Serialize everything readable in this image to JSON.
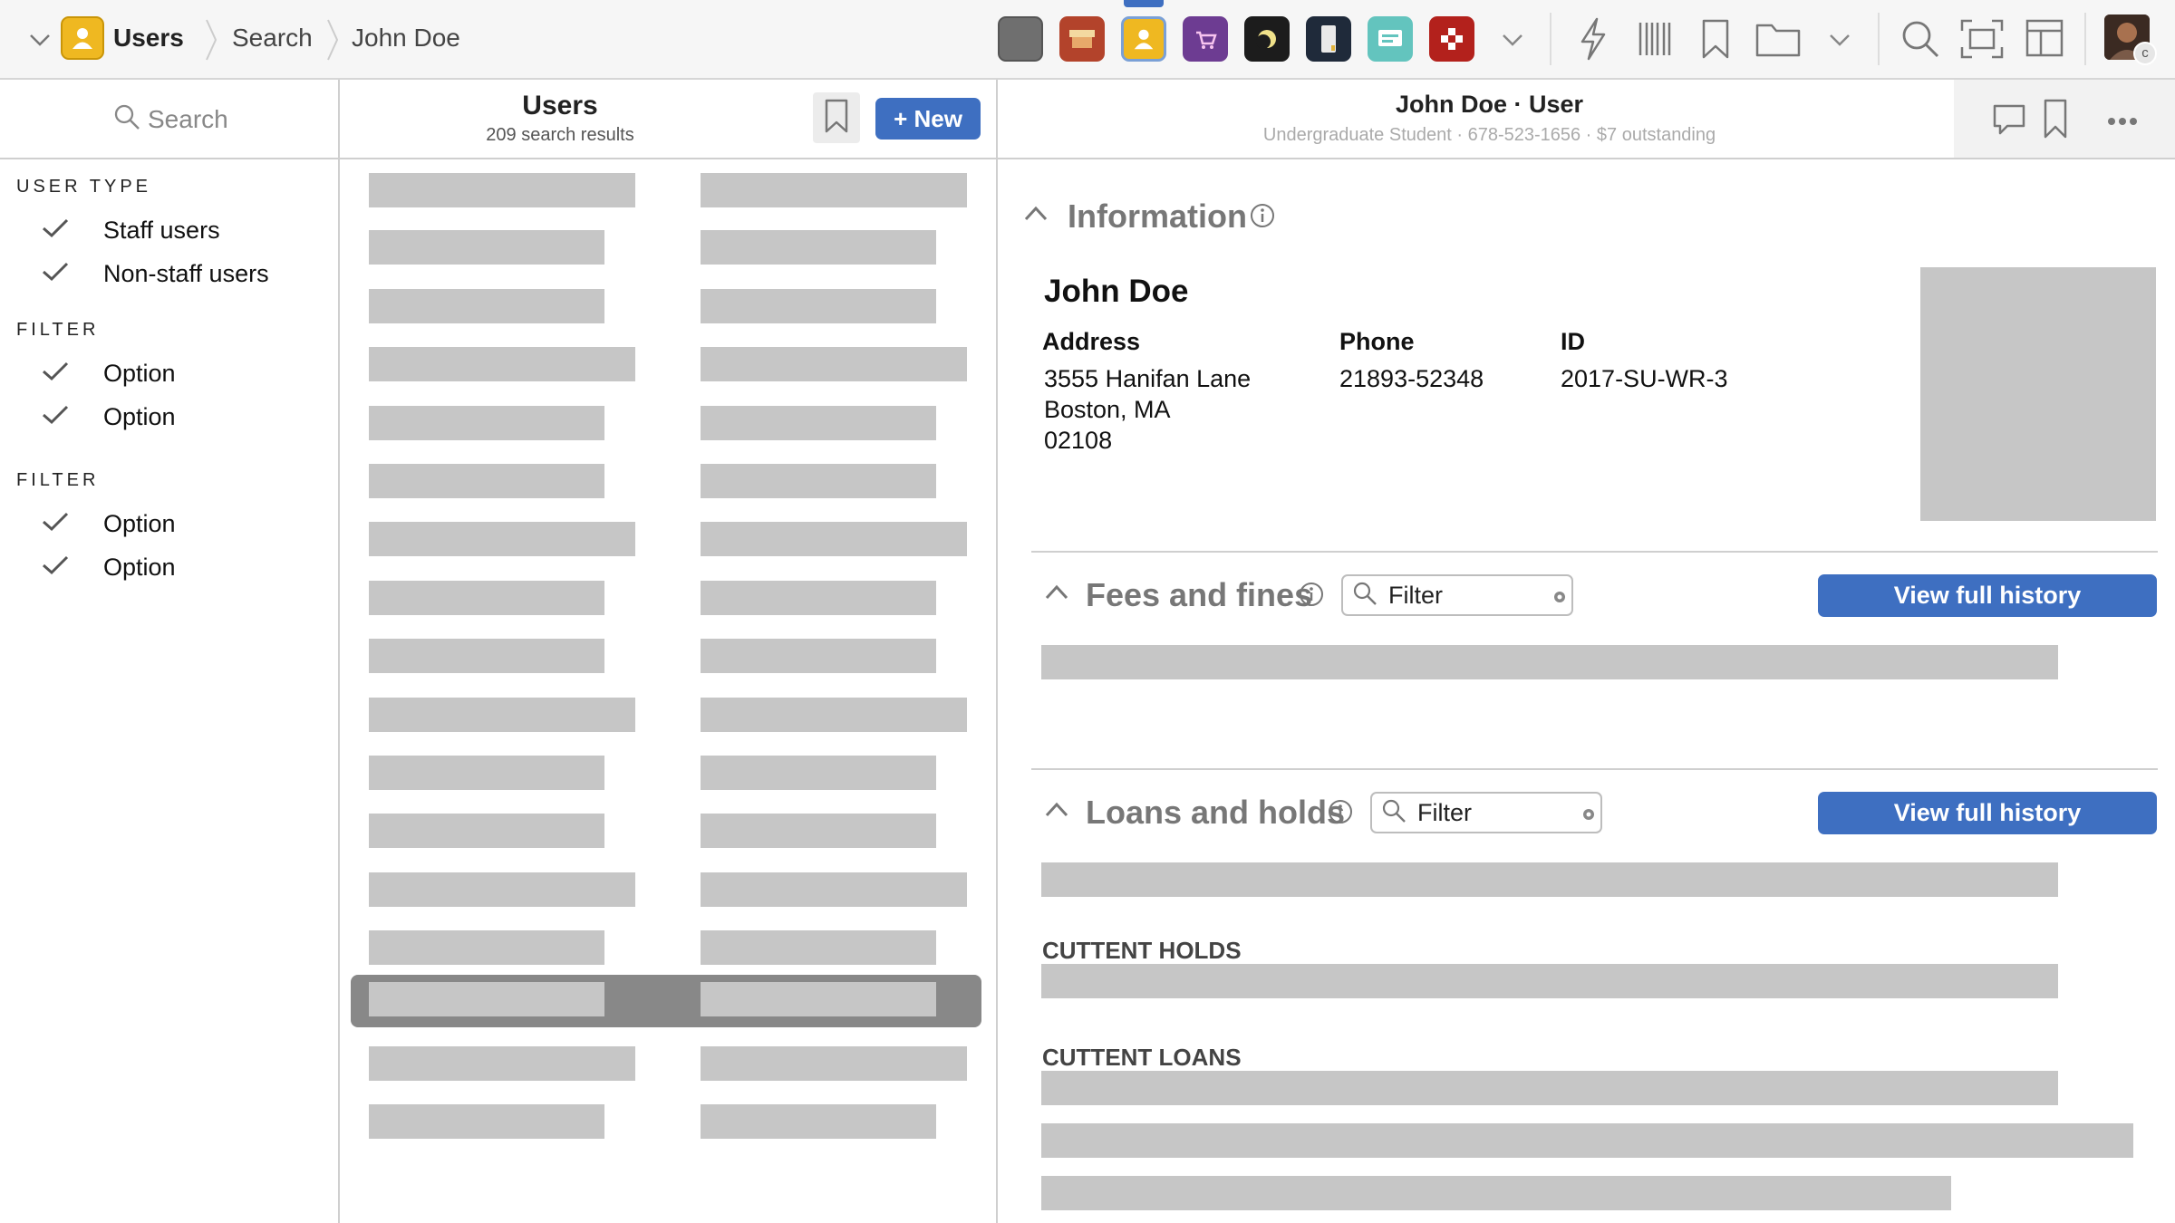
{
  "topbar": {
    "app_name": "Users",
    "breadcrumb": [
      "Search",
      "John Doe"
    ],
    "app_icons": [
      "dashboard-app-icon",
      "inventory-app-icon",
      "users-app-icon",
      "orders-app-icon",
      "night-app-icon",
      "device-app-icon",
      "courses-app-icon",
      "settings-app-icon"
    ],
    "tool_icons": [
      "lightning-icon",
      "barcode-icon",
      "bookmark-icon",
      "folder-icon",
      "search-icon",
      "fullscreen-icon",
      "layout-icon"
    ],
    "avatar_badge": "c"
  },
  "filters": {
    "search_placeholder": "Search",
    "groups": [
      {
        "title": "USER TYPE",
        "options": [
          "Staff users",
          "Non-staff users"
        ]
      },
      {
        "title": "FILTER",
        "options": [
          "Option",
          "Option"
        ]
      },
      {
        "title": "FILTER",
        "options": [
          "Option",
          "Option"
        ]
      }
    ]
  },
  "results": {
    "title": "Users",
    "subtitle": "209 search results",
    "new_button": "+ New",
    "row_count": 17,
    "selected_row_index": 14
  },
  "detail": {
    "title": "John Doe · User",
    "subtitle": "Undergraduate Student · 678-523-1656 · $7 outstanding",
    "information": {
      "heading": "Information",
      "name": "John Doe",
      "address_label": "Address",
      "address_lines": [
        "3555 Hanifan Lane",
        "Boston, MA",
        "02108"
      ],
      "phone_label": "Phone",
      "phone": "21893-52348",
      "id_label": "ID",
      "id": "2017-SU-WR-3"
    },
    "fees": {
      "heading": "Fees and fines",
      "filter_placeholder": "Filter",
      "button": "View full history"
    },
    "loans": {
      "heading": "Loans and holds",
      "filter_placeholder": "Filter",
      "button": "View full history",
      "holds_label": "CUTTENT HOLDS",
      "loans_label": "CUTTENT LOANS"
    }
  },
  "colors": {
    "accent_blue": "#3e6fc1",
    "placeholder_gray": "#c6c6c6",
    "selected_row": "#888888"
  }
}
